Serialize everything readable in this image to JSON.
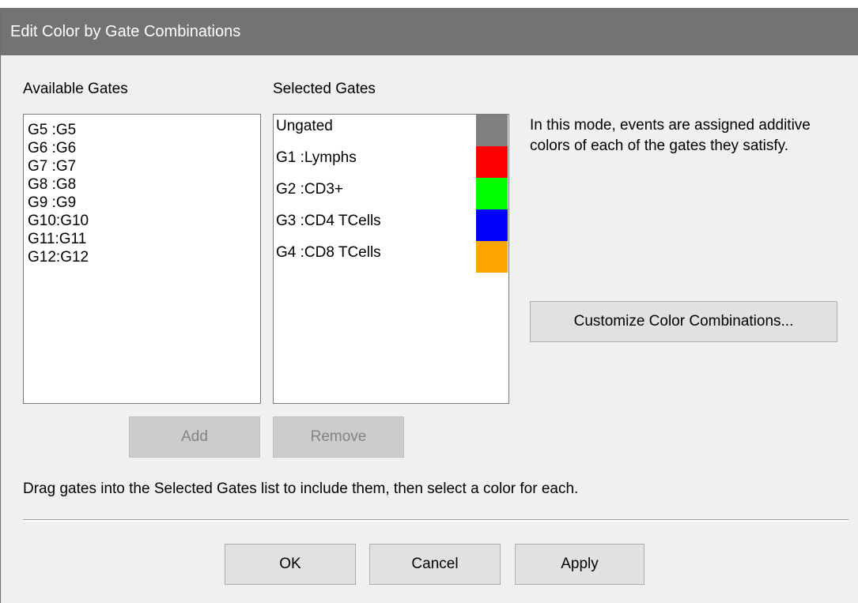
{
  "window": {
    "title": "Edit Color by Gate Combinations"
  },
  "available": {
    "heading": "Available Gates",
    "items": [
      "G5 :G5",
      "G6 :G6",
      "G7 :G7",
      "G8 :G8",
      "G9 :G9",
      "G10:G10",
      "G11:G11",
      "G12:G12"
    ]
  },
  "selected": {
    "heading": "Selected Gates",
    "items": [
      {
        "label": "Ungated",
        "color": "#808080"
      },
      {
        "label": "G1 :Lymphs",
        "color": "#ff0000"
      },
      {
        "label": "G2 :CD3+",
        "color": "#00ff00"
      },
      {
        "label": "G3 :CD4 TCells",
        "color": "#0000ff"
      },
      {
        "label": "G4 :CD8 TCells",
        "color": "#ffa500"
      }
    ]
  },
  "info_text": "In this mode, events are assigned additive colors of each of the gates they satisfy.",
  "buttons": {
    "customize": "Customize Color Combinations...",
    "add": "Add",
    "remove": "Remove",
    "ok": "OK",
    "cancel": "Cancel",
    "apply": "Apply"
  },
  "hint": "Drag gates into the Selected Gates list to include them, then select a color for each."
}
